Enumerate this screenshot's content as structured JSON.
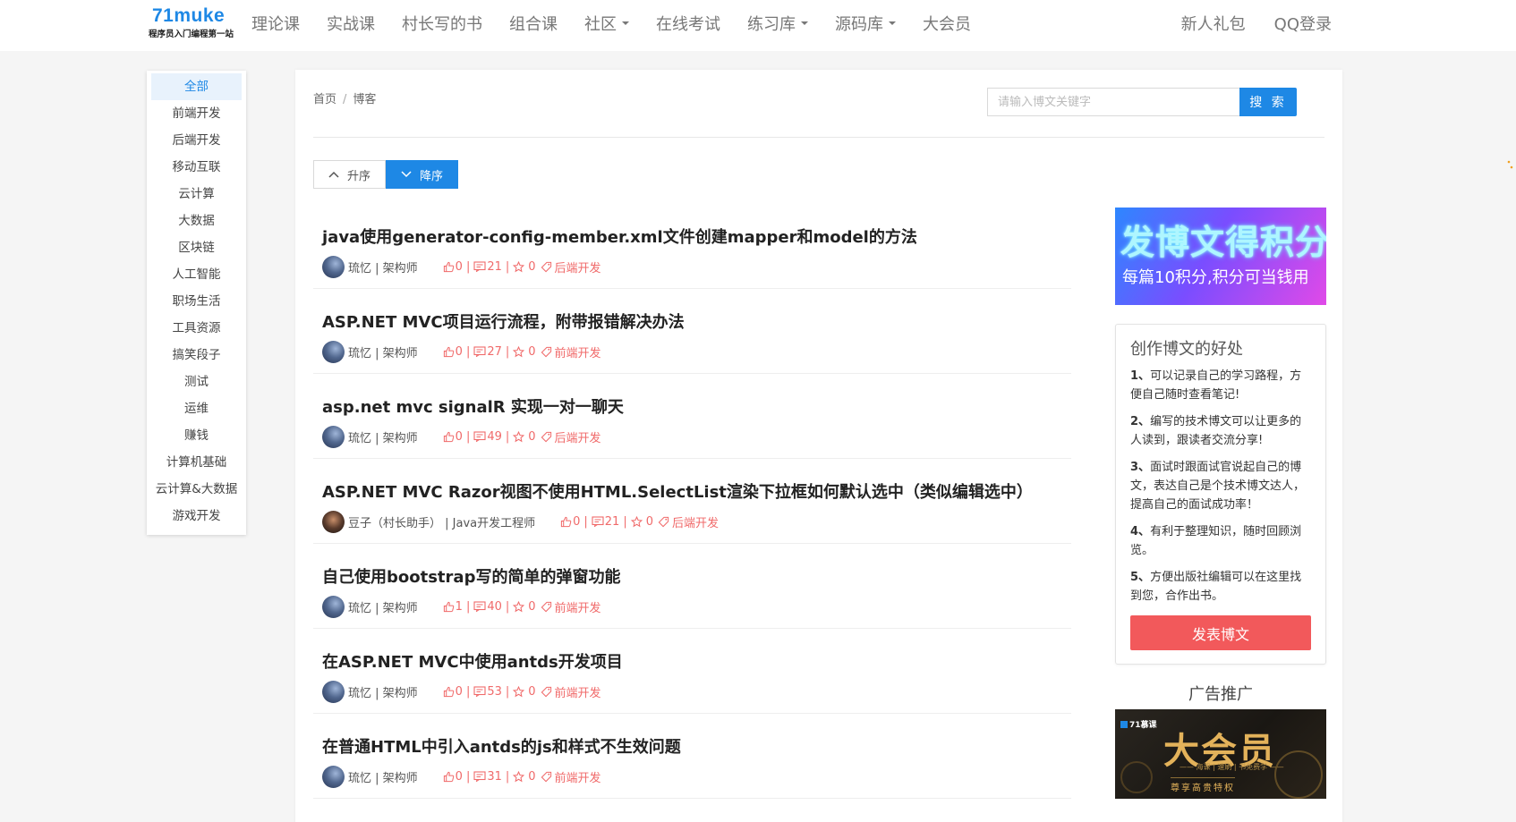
{
  "header": {
    "logo_main": "71muke",
    "logo_sub": "程序员入门编程第一站",
    "nav": [
      {
        "label": "理论课",
        "dropdown": false
      },
      {
        "label": "实战课",
        "dropdown": false
      },
      {
        "label": "村长写的书",
        "dropdown": false
      },
      {
        "label": "组合课",
        "dropdown": false
      },
      {
        "label": "社区",
        "dropdown": true
      },
      {
        "label": "在线考试",
        "dropdown": false
      },
      {
        "label": "练习库",
        "dropdown": true
      },
      {
        "label": "源码库",
        "dropdown": true
      },
      {
        "label": "大会员",
        "dropdown": false
      }
    ],
    "right": {
      "gift": "新人礼包",
      "login": "QQ登录"
    }
  },
  "sidebar": {
    "categories": [
      "全部",
      "前端开发",
      "后端开发",
      "移动互联",
      "云计算",
      "大数据",
      "区块链",
      "人工智能",
      "职场生活",
      "工具资源",
      "搞笑段子",
      "测试",
      "运维",
      "赚钱",
      "计算机基础",
      "云计算&大数据",
      "游戏开发"
    ],
    "active_index": 0
  },
  "breadcrumb": {
    "home": "首页",
    "separator": "/",
    "current": "博客"
  },
  "search": {
    "placeholder": "请输入博文关键字",
    "button": "搜 索"
  },
  "sort": {
    "asc": "升序",
    "desc": "降序",
    "active": "desc"
  },
  "articles": [
    {
      "title": "java使用generator-config-member.xml文件创建mapper和model的方法",
      "author": "琉忆 | 架构师",
      "likes": "0",
      "comments": "21",
      "stars": "0",
      "category": "后端开发",
      "avatar": "a"
    },
    {
      "title": "ASP.NET MVC项目运行流程，附带报错解决办法",
      "author": "琉忆 | 架构师",
      "likes": "0",
      "comments": "27",
      "stars": "0",
      "category": "前端开发",
      "avatar": "a"
    },
    {
      "title": "asp.net mvc signalR 实现一对一聊天",
      "author": "琉忆 | 架构师",
      "likes": "0",
      "comments": "49",
      "stars": "0",
      "category": "后端开发",
      "avatar": "a"
    },
    {
      "title": "ASP.NET MVC Razor视图不使用HTML.SelectList渲染下拉框如何默认选中（类似编辑选中）",
      "author": "豆子（村长助手） | Java开发工程师",
      "likes": "0",
      "comments": "21",
      "stars": "0",
      "category": "后端开发",
      "avatar": "b"
    },
    {
      "title": "自己使用bootstrap写的简单的弹窗功能",
      "author": "琉忆 | 架构师",
      "likes": "1",
      "comments": "40",
      "stars": "0",
      "category": "前端开发",
      "avatar": "a"
    },
    {
      "title": "在ASP.NET MVC中使用antds开发项目",
      "author": "琉忆 | 架构师",
      "likes": "0",
      "comments": "53",
      "stars": "0",
      "category": "前端开发",
      "avatar": "a"
    },
    {
      "title": "在普通HTML中引入antds的js和样式不生效问题",
      "author": "琉忆 | 架构师",
      "likes": "0",
      "comments": "31",
      "stars": "0",
      "category": "前端开发",
      "avatar": "a"
    }
  ],
  "promo": {
    "title": "发博文得积分",
    "subtitle": "每篇10积分,积分可当钱用"
  },
  "benefits": {
    "title": "创作博文的好处",
    "items": [
      {
        "num": "1",
        "text": "可以记录自己的学习路程，方便自己随时查看笔记!"
      },
      {
        "num": "2",
        "text": "编写的技术博文可以让更多的人读到，跟读者交流分享!"
      },
      {
        "num": "3",
        "text": "面试时跟面试官说起自己的博文，表达自己是个技术博文达人， 提高自己的面试成功率！"
      },
      {
        "num": "4",
        "text": "有利于整理知识，随时回顾浏览。"
      },
      {
        "num": "5",
        "text": "方便出版社编辑可以在这里找到您，合作出书。"
      }
    ],
    "button": "发表博文"
  },
  "ad": {
    "title": "广告推广",
    "logo": "71慕课",
    "main": "大会员",
    "tags": "—— 海课 | 速刷 | 书免费学 ——",
    "footer": "尊享高贵特权"
  },
  "colors": {
    "accent": "#1e88e5",
    "stats": "#f06a6a",
    "post_button": "#f2595b"
  }
}
